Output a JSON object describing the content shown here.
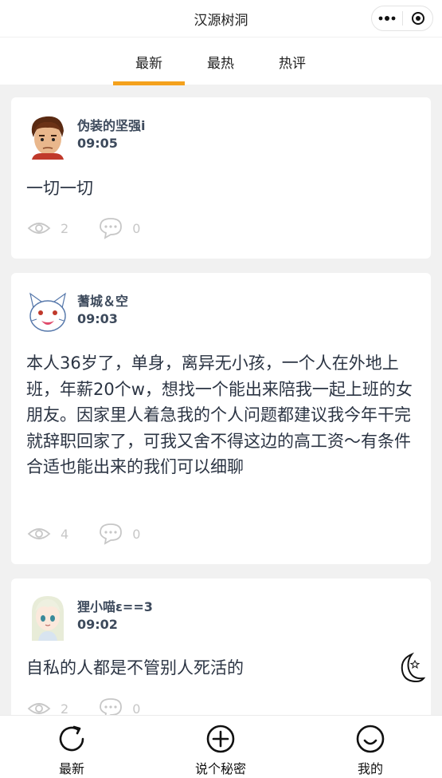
{
  "app": {
    "title": "汉源树洞"
  },
  "tabs": [
    {
      "label": "最新",
      "active": true
    },
    {
      "label": "最热",
      "active": false
    },
    {
      "label": "热评",
      "active": false
    }
  ],
  "posts": [
    {
      "user": "伪装的坚强i",
      "time": "09:05",
      "content": "一切一切",
      "views": "2",
      "comments": "0",
      "avatar": "cartoon-boy-avatar"
    },
    {
      "user": "蓍城＆空",
      "time": "09:03",
      "content": "本人36岁了，单身，离异无小孩，一个人在外地上班，年薪20个w，想找一个能出来陪我一起上班的女朋友。因家里人着急我的个人问题都建议我今年干完就辞职回家了，可我又舍不得这边的高工资～有条件合适也能出来的我们可以细聊",
      "views": "4",
      "comments": "0",
      "avatar": "white-cat-avatar"
    },
    {
      "user": "狸小喵ε==3",
      "time": "09:02",
      "content": "自私的人都是不管别人死活的",
      "views": "2",
      "comments": "0",
      "avatar": "anime-girl-avatar"
    }
  ],
  "bottom_nav": [
    {
      "label": "最新",
      "icon": "refresh-icon"
    },
    {
      "label": "说个秘密",
      "icon": "plus-circle-icon"
    },
    {
      "label": "我的",
      "icon": "smile-icon"
    }
  ],
  "colors": {
    "accent": "#f4a11c",
    "username": "#3d4a5c",
    "text": "#2b3443",
    "muted": "#c7c7c7"
  }
}
